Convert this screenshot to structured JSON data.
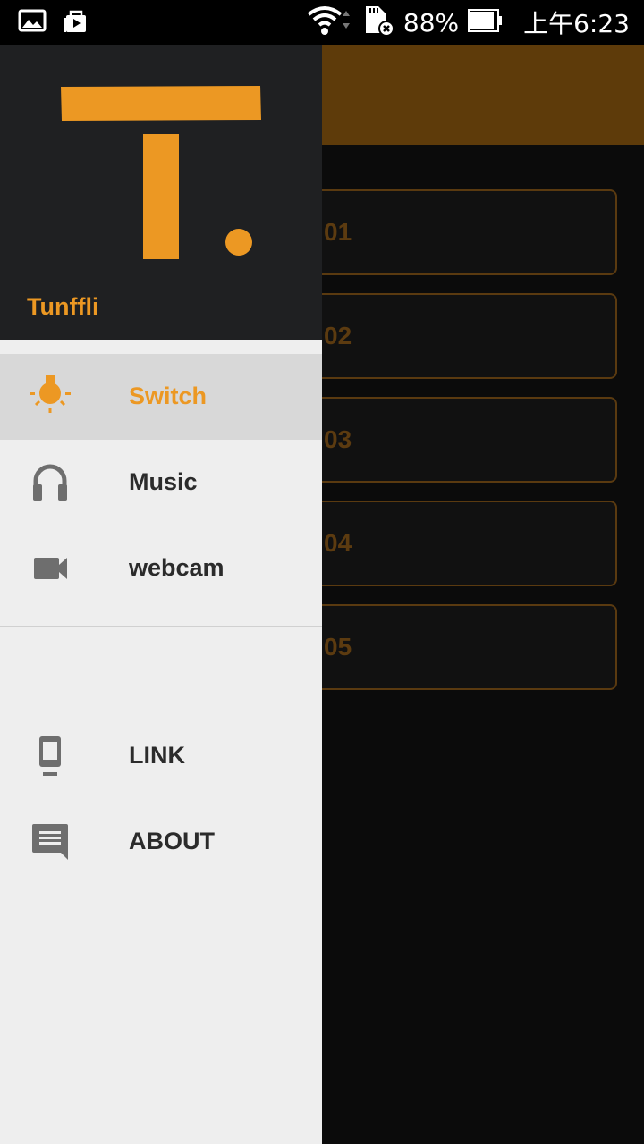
{
  "status_bar": {
    "battery": "88%",
    "time": "上午6:23",
    "icons": [
      "gallery-icon",
      "play-store-icon",
      "wifi-icon",
      "sd-card-error-icon",
      "battery-icon"
    ]
  },
  "app": {
    "items": [
      {
        "label": "01"
      },
      {
        "label": "02"
      },
      {
        "label": "03"
      },
      {
        "label": "04"
      },
      {
        "label": "05"
      }
    ]
  },
  "drawer": {
    "app_name": "Tunffli",
    "menu": [
      {
        "label": "Switch",
        "icon": "lightbulb-icon",
        "active": true
      },
      {
        "label": "Music",
        "icon": "headphones-icon",
        "active": false
      },
      {
        "label": "webcam",
        "icon": "videocam-icon",
        "active": false
      }
    ],
    "secondary": [
      {
        "label": "LINK",
        "icon": "phone-icon"
      },
      {
        "label": "ABOUT",
        "icon": "message-icon"
      }
    ]
  },
  "colors": {
    "accent": "#ec9823",
    "header_bg": "#1f2022",
    "drawer_bg": "#eeeeee",
    "toolbar_dimmed": "#5e3b0a"
  }
}
